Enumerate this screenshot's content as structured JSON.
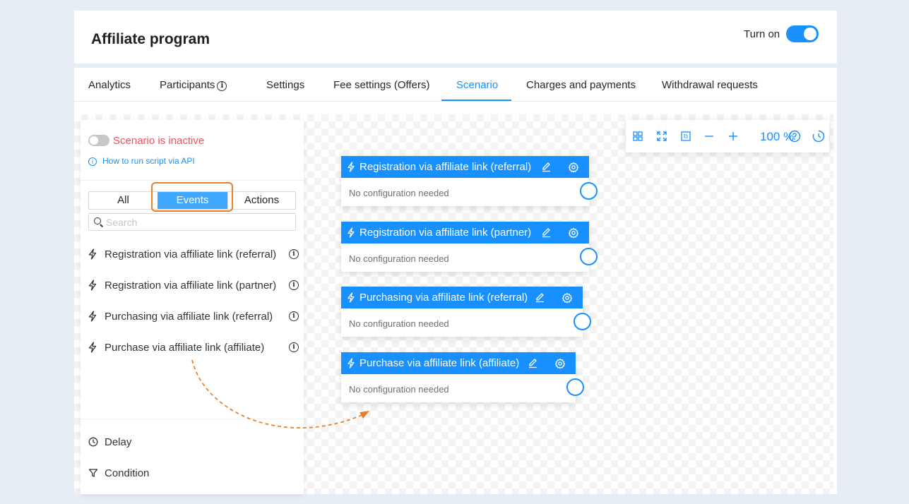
{
  "header": {
    "title": "Affiliate program",
    "toggle_label": "Turn on",
    "toggle_on": true
  },
  "tabs": [
    {
      "label": "Analytics",
      "active": false
    },
    {
      "label": "Participants",
      "active": false,
      "has_info": true
    },
    {
      "label": "Settings",
      "active": false
    },
    {
      "label": "Fee settings (Offers)",
      "active": false
    },
    {
      "label": "Scenario",
      "active": true
    },
    {
      "label": "Charges and payments",
      "active": false
    },
    {
      "label": "Withdrawal requests",
      "active": false
    }
  ],
  "sidebar": {
    "status_text": "Scenario is inactive",
    "api_link": "How to run script via API",
    "filters": [
      "All",
      "Events",
      "Actions"
    ],
    "selected_filter": "Events",
    "search_placeholder": "Search",
    "events": [
      "Registration via affiliate link (referral)",
      "Registration via affiliate link (partner)",
      "Purchasing via affiliate link (referral)",
      "Purchase via affiliate link (affiliate)"
    ],
    "bottom_items": [
      "Delay",
      "Condition"
    ]
  },
  "toolbar": {
    "icons": [
      "grid-icon",
      "fullscreen-icon",
      "fit-icon",
      "zoom-out-icon",
      "zoom-in-icon"
    ],
    "zoom": "100 %",
    "extra_icons": [
      "help-icon",
      "history-icon"
    ]
  },
  "nodes": [
    {
      "title": "Registration via affiliate link (referral)",
      "body": "No configuration needed"
    },
    {
      "title": "Registration via affiliate link (partner)",
      "body": "No configuration needed"
    },
    {
      "title": "Purchasing via affiliate link (referral)",
      "body": "No configuration needed"
    },
    {
      "title": "Purchase via affiliate link (affiliate)",
      "body": "No configuration needed"
    }
  ],
  "colors": {
    "accent": "#1890ff",
    "inactive": "#f5222d",
    "highlight": "#e6802d"
  }
}
